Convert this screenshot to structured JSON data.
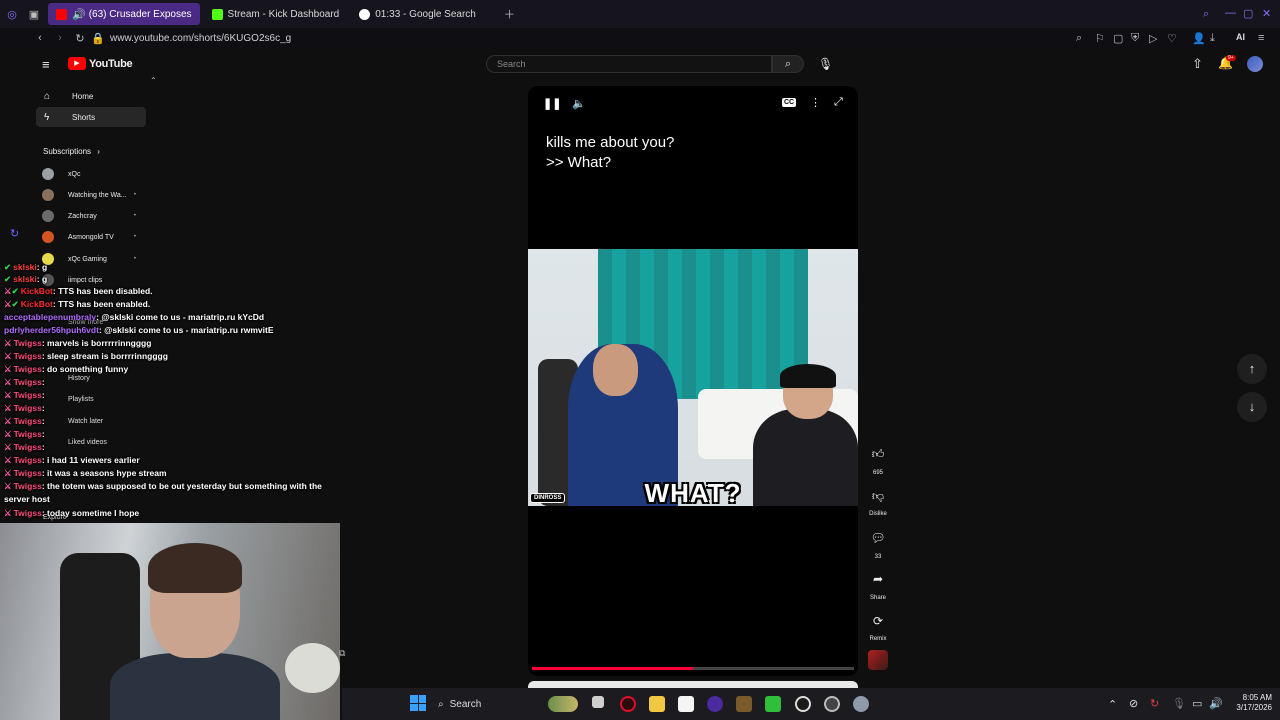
{
  "browser": {
    "tabs": [
      {
        "label": "(63) Crusader Exposes",
        "active": true,
        "favicon_color": "#ff0000"
      },
      {
        "label": "Stream - Kick Dashboard",
        "active": false,
        "favicon_color": "#53fc18"
      },
      {
        "label": "01:33 - Google Search",
        "active": false,
        "favicon_color": "#ffffff"
      }
    ],
    "url": "www.youtube.com/shorts/6KUGO2s6c_g",
    "ai_label": "AI"
  },
  "youtube": {
    "logo": "YouTube",
    "search_placeholder": "Search",
    "notification_count": "9+"
  },
  "sidebar": {
    "items": [
      {
        "label": "Home",
        "icon": "home-icon"
      },
      {
        "label": "Shorts",
        "icon": "shorts-icon"
      }
    ],
    "subscriptions_title": "Subscriptions",
    "subscriptions": [
      {
        "label": "xQc",
        "color": "#9aa0a6"
      },
      {
        "label": "Watching the Wa...",
        "color": "#8c6f5a"
      },
      {
        "label": "Zachcray",
        "color": "#6a6a6a"
      },
      {
        "label": "Asmongold TV",
        "color": "#d4551f"
      },
      {
        "label": "xQc Gaming",
        "color": "#e6d94a"
      },
      {
        "label": "iimpct clips",
        "color": "#555555"
      }
    ],
    "show_more": "Show more",
    "you_items": [
      "History",
      "Playlists",
      "Watch later",
      "Liked videos"
    ],
    "explore": "Explore"
  },
  "chat": [
    {
      "user": "sklski",
      "text": "g",
      "user_color": "#ff4040"
    },
    {
      "user": "sklski",
      "text": "g",
      "user_color": "#ff4040"
    },
    {
      "user": "KickBot",
      "text": "TTS has been disabled.",
      "user_color": "#ff2a2a"
    },
    {
      "user": "KickBot",
      "text": "TTS has been enabled.",
      "user_color": "#ff2a2a"
    },
    {
      "user": "acceptablepenumbraly",
      "text": "@sklski come to us - mariatrip.ru kYcDd",
      "user_color": "#b26bff"
    },
    {
      "user": "pdrlyherder56hpuh6vdt",
      "text": "@sklski come to us - mariatrip.ru rwmvitE",
      "user_color": "#b26bff"
    },
    {
      "user": "Twigss",
      "text": "marvels is borrrrrinngggg",
      "user_color": "#ff4a7a"
    },
    {
      "user": "Twigss",
      "text": "sleep stream is borrrrinngggg",
      "user_color": "#ff4a7a"
    },
    {
      "user": "Twigss",
      "text": "do something funny",
      "user_color": "#ff4a7a"
    },
    {
      "user": "Twigss",
      "text": "",
      "user_color": "#ff4a7a"
    },
    {
      "user": "Twigss",
      "text": "",
      "user_color": "#ff4a7a"
    },
    {
      "user": "Twigss",
      "text": "",
      "user_color": "#ff4a7a"
    },
    {
      "user": "Twigss",
      "text": "",
      "user_color": "#ff4a7a"
    },
    {
      "user": "Twigss",
      "text": "",
      "user_color": "#ff4a7a"
    },
    {
      "user": "Twigss",
      "text": "",
      "user_color": "#ff4a7a"
    },
    {
      "user": "Twigss",
      "text": "i had 11 viewers earlier",
      "user_color": "#ff4a7a"
    },
    {
      "user": "Twigss",
      "text": "it was a seasons hype stream",
      "user_color": "#ff4a7a"
    },
    {
      "user": "Twigss",
      "text": "the totem was supposed to be out yesterday but something with the",
      "user_color": "#ff4a7a"
    },
    {
      "user": "",
      "text": "server host",
      "user_color": "#ff4a7a"
    },
    {
      "user": "Twigss",
      "text": "today sometime I hope",
      "user_color": "#ff4a7a"
    }
  ],
  "player": {
    "caption_line1": "kills me about you?",
    "caption_line2": ">> What?",
    "video_text": "WHAT?",
    "watermark": "DINROSS",
    "progress": 0.5,
    "actions": [
      {
        "name": "like",
        "icon": "thumbs-up-icon",
        "label": "695"
      },
      {
        "name": "dislike",
        "icon": "thumbs-down-icon",
        "label": "Dislike"
      },
      {
        "name": "comments",
        "icon": "comment-icon",
        "label": "33"
      },
      {
        "name": "share",
        "icon": "share-icon",
        "label": "Share"
      },
      {
        "name": "remix",
        "icon": "remix-icon",
        "label": "Remix"
      }
    ]
  },
  "taskbar": {
    "search_label": "Search",
    "time": "8:05 AM",
    "date": "3/17/2026"
  }
}
